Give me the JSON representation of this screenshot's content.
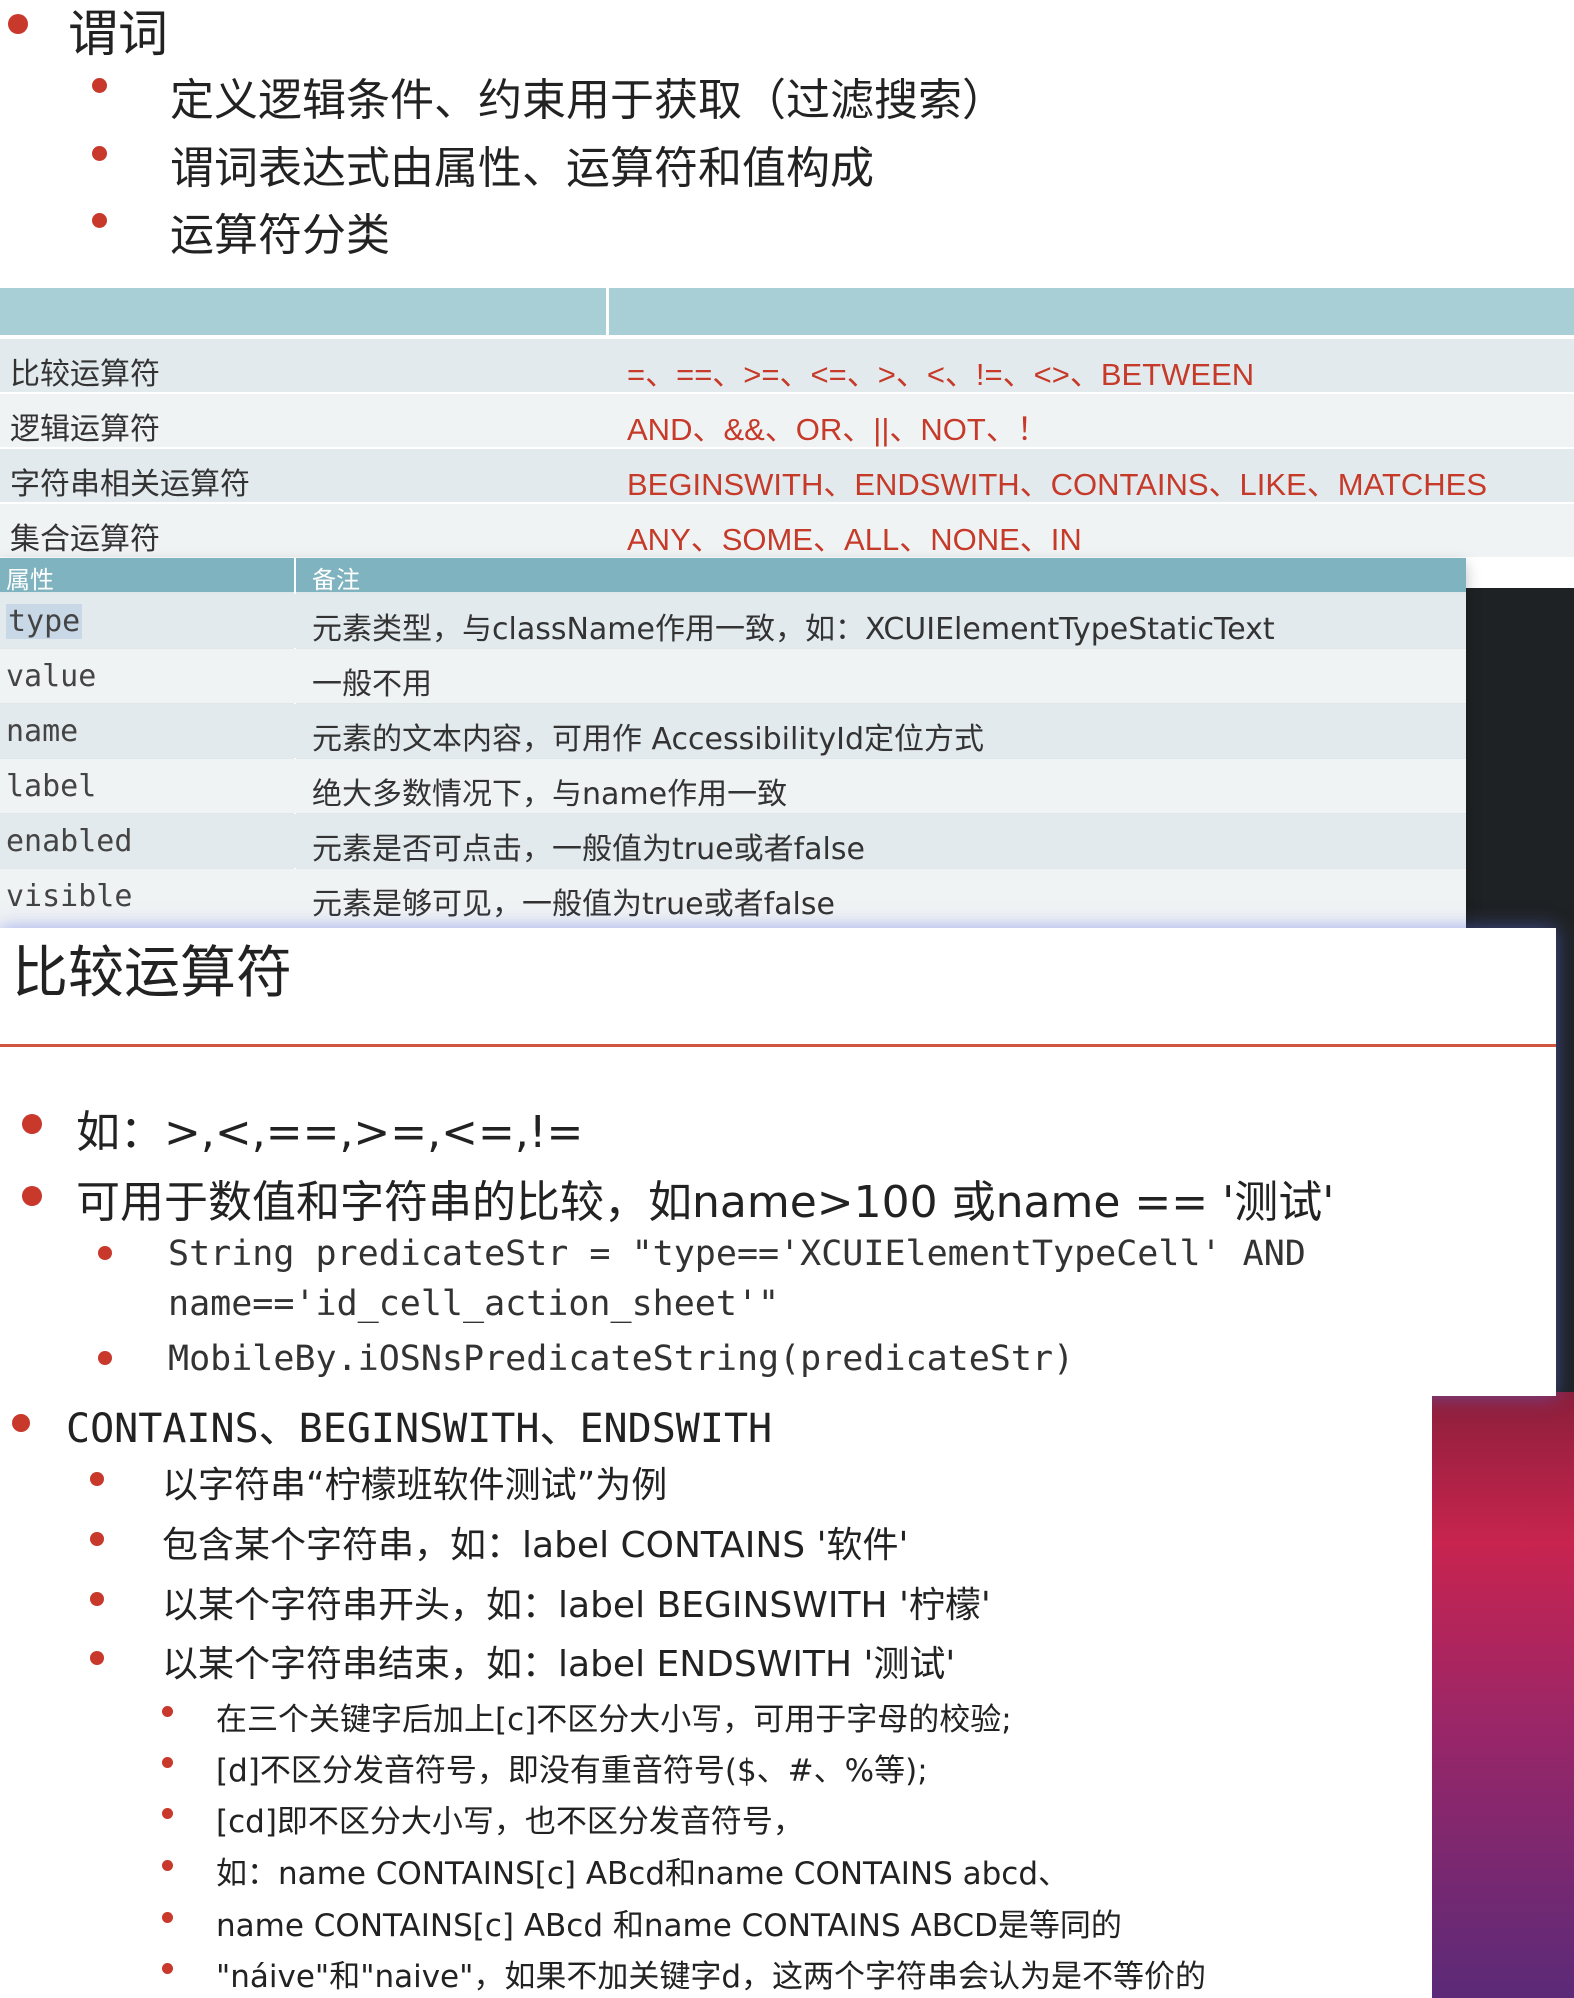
{
  "section1": {
    "heading": "谓词",
    "bullets": [
      "定义逻辑条件、约束用于获取（过滤搜索）",
      "谓词表达式由属性、运算符和值构成",
      "运算符分类"
    ]
  },
  "operator_table": {
    "rows": [
      {
        "category": "比较运算符",
        "ops": "=、==、>=、<=、>、<、!=、<>、BETWEEN"
      },
      {
        "category": "逻辑运算符",
        "ops": "AND、&&、OR、||、NOT、！"
      },
      {
        "category": "字符串相关运算符",
        "ops": "BEGINSWITH、ENDSWITH、CONTAINS、LIKE、MATCHES"
      },
      {
        "category": "集合运算符",
        "ops": "ANY、SOME、ALL、NONE、IN"
      }
    ]
  },
  "attribute_table": {
    "headers": [
      "属性",
      "备注"
    ],
    "rows": [
      {
        "attr": "type",
        "note": "元素类型，与className作用一致，如：XCUIElementTypeStaticText"
      },
      {
        "attr": "value",
        "note": "一般不用"
      },
      {
        "attr": "name",
        "note": "元素的文本内容，可用作 AccessibilityId定位方式"
      },
      {
        "attr": "label",
        "note": "绝大多数情况下，与name作用一致"
      },
      {
        "attr": "enabled",
        "note": "元素是否可点击，一般值为true或者false"
      },
      {
        "attr": "visible",
        "note": "元素是够可见，一般值为true或者false"
      }
    ]
  },
  "compare_slide": {
    "title": "比较运算符",
    "bullet1": "如：>,<,==,>=,<=,!=",
    "bullet2": "可用于数值和字符串的比较，如name>100 或name == '测试'",
    "code1_line1": "String predicateStr = \"type=='XCUIElementTypeCell' AND",
    "code1_line2": "name=='id_cell_action_sheet'\"",
    "code2": "MobileBy.iOSNsPredicateString(predicateStr)"
  },
  "string_slide": {
    "heading": "CONTAINS、BEGINSWITH、ENDSWITH",
    "items": [
      "以字符串“柠檬班软件测试”为例",
      "包含某个字符串，如：label CONTAINS '软件'",
      "以某个字符串开头，如：label BEGINSWITH '柠檬'",
      "以某个字符串结束，如：label ENDSWITH '测试'"
    ],
    "subitems": [
      "在三个关键字后加上[c]不区分大小写，可用于字母的校验;",
      "[d]不区分发音符号，即没有重音符号($、#、%等);",
      "[cd]即不区分大小写，也不区分发音符号，",
      "如：name CONTAINS[c] ABcd和name CONTAINS abcd、",
      "name CONTAINS[c] ABcd 和name CONTAINS ABCD是等同的",
      "\"náive\"和\"naive\"，如果不加关键字d，这两个字符串会认为是不等价的"
    ]
  },
  "colors": {
    "accent_red": "#c63a29",
    "table_header": "#a9cfd6",
    "attr_header": "#7fb3bf"
  }
}
